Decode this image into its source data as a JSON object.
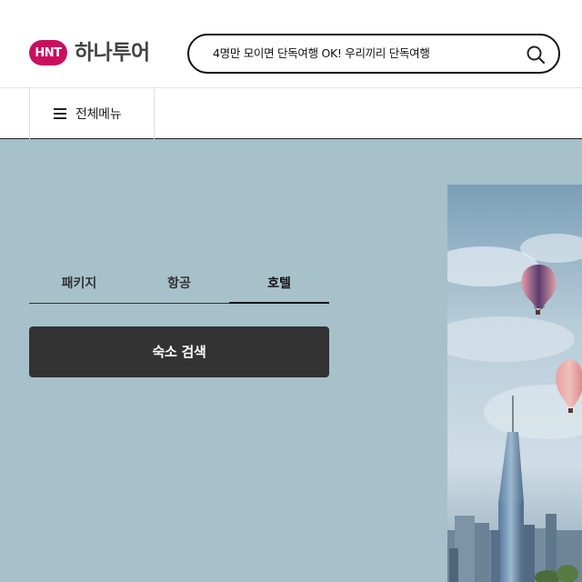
{
  "header": {
    "logo_badge": "HNT",
    "logo_text": "하나투어",
    "search_text": "4명만 모이면 단독여행 OK! 우리끼리 단독여행",
    "search_icon": "search-icon"
  },
  "nav": {
    "menu_label": "전체메뉴",
    "menu_icon": "hamburger-icon"
  },
  "hero": {
    "tabs": [
      {
        "label": "패키지",
        "active": false
      },
      {
        "label": "항공",
        "active": false
      },
      {
        "label": "호텔",
        "active": true
      }
    ],
    "search_button": "숙소 검색",
    "image": "hot-air-balloons-over-city-skyline"
  },
  "colors": {
    "brand": "#c8105e",
    "hero_bg": "#a6c1ca",
    "button_bg": "#333333"
  }
}
